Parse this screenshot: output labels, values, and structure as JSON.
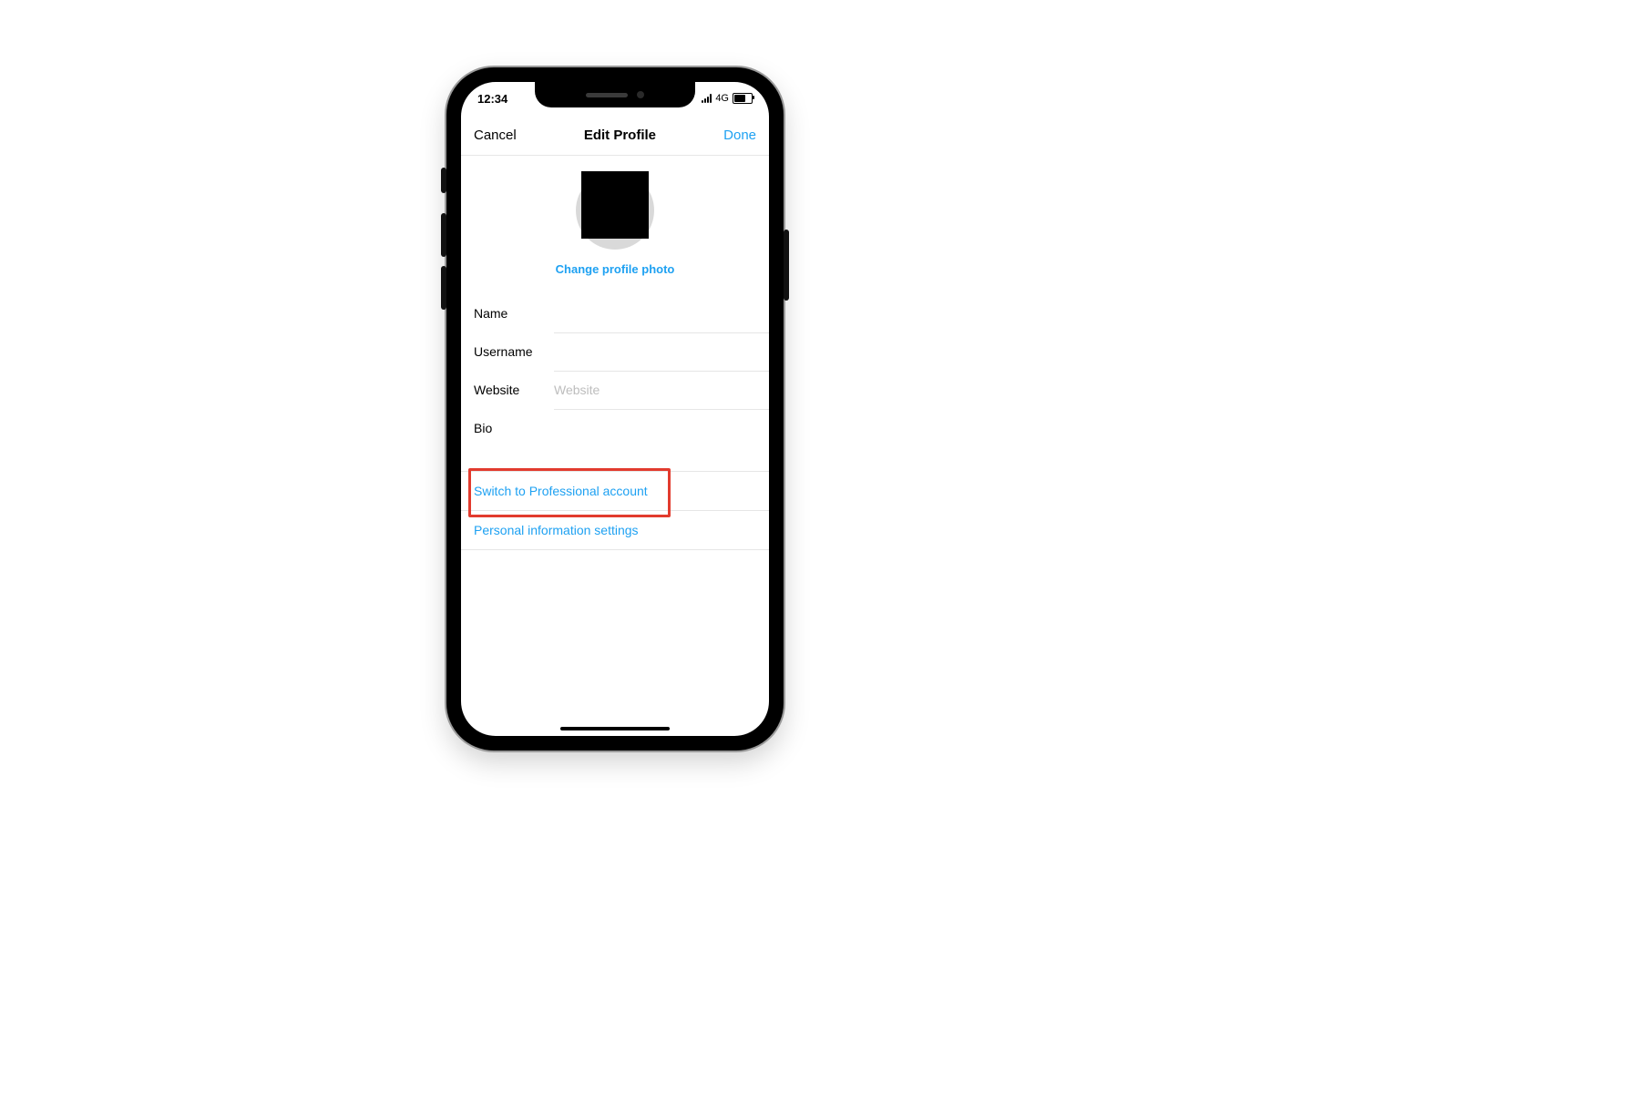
{
  "status": {
    "time": "12:34",
    "network": "4G"
  },
  "nav": {
    "cancel": "Cancel",
    "title": "Edit Profile",
    "done": "Done"
  },
  "profile": {
    "change_photo": "Change profile photo"
  },
  "fields": {
    "name": {
      "label": "Name",
      "value": "",
      "placeholder": ""
    },
    "username": {
      "label": "Username",
      "value": "",
      "placeholder": ""
    },
    "website": {
      "label": "Website",
      "value": "",
      "placeholder": "Website"
    },
    "bio": {
      "label": "Bio",
      "value": "",
      "placeholder": ""
    }
  },
  "links": {
    "switch_pro": "Switch to Professional account",
    "personal_info": "Personal information settings"
  },
  "colors": {
    "accent": "#1ea1f2",
    "highlight": "#e23b2e"
  }
}
